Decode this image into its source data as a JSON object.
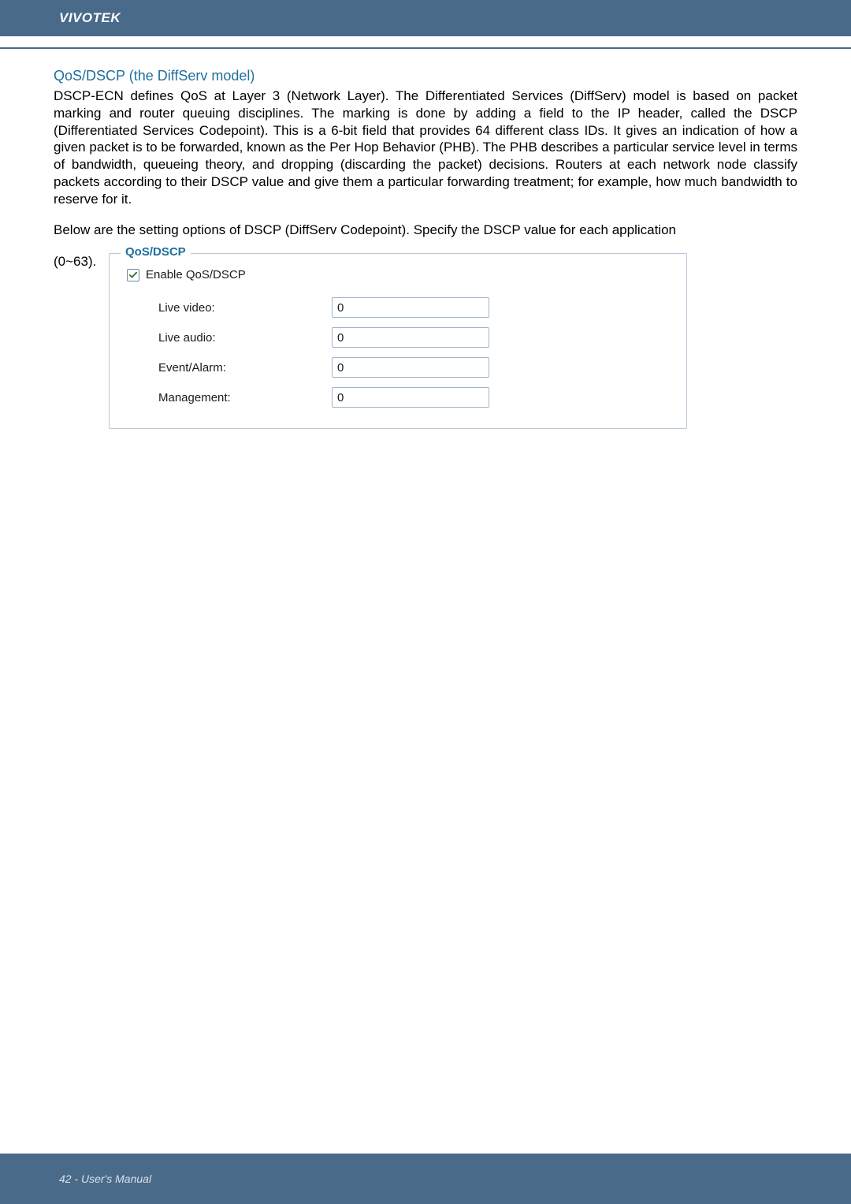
{
  "header": {
    "brand": "VIVOTEK"
  },
  "section": {
    "title": "QoS/DSCP (the DiffServ model)",
    "para1": "DSCP-ECN defines QoS at Layer 3 (Network Layer). The Differentiated Services (DiffServ) model is based on packet marking and router queuing disciplines. The marking is done by adding a field to the IP header, called the DSCP (Differentiated Services Codepoint). This is a 6-bit field that provides 64 different class IDs. It gives an indication of how a given packet is to be forwarded, known as the Per Hop Behavior (PHB). The PHB describes a particular service level in terms of bandwidth, queueing theory, and dropping (discarding the packet) decisions. Routers at each network node classify packets according to their DSCP value and give them a particular forwarding treatment; for example, how much bandwidth to reserve for it.",
    "para2": "Below are the setting options of DSCP (DiffServ Codepoint). Specify the DSCP value for each application",
    "range_suffix": "(0~63)."
  },
  "panel": {
    "legend": "QoS/DSCP",
    "enable_label": "Enable QoS/DSCP",
    "enabled": true,
    "fields": {
      "live_video": {
        "label": "Live video:",
        "value": "0"
      },
      "live_audio": {
        "label": "Live audio:",
        "value": "0"
      },
      "event_alarm": {
        "label": "Event/Alarm:",
        "value": "0"
      },
      "management": {
        "label": "Management:",
        "value": "0"
      }
    }
  },
  "footer": {
    "text": "42 - User's Manual"
  }
}
